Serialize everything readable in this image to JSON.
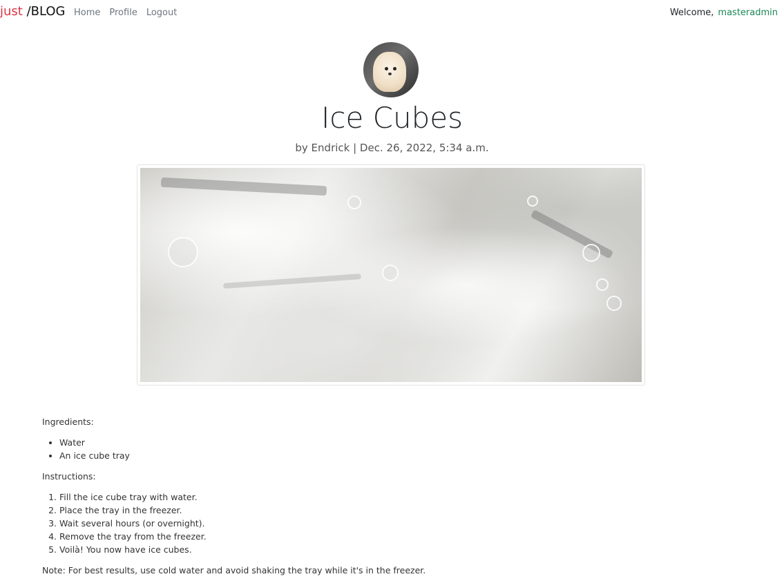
{
  "navbar": {
    "brand_part1": "just",
    "brand_part2": " /BLOG",
    "links": [
      "Home",
      "Profile",
      "Logout"
    ],
    "welcome_label": "Welcome,",
    "username": "masteradmin"
  },
  "post": {
    "title": "Ice Cubes",
    "byline": "by Endrick | Dec. 26, 2022, 5:34 a.m.",
    "ingredients_label": "Ingredients:",
    "ingredients": [
      "Water",
      "An ice cube tray"
    ],
    "instructions_label": "Instructions:",
    "instructions": [
      "Fill the ice cube tray with water.",
      "Place the tray in the freezer.",
      "Wait several hours (or overnight).",
      "Remove the tray from the freezer.",
      "Voilà! You now have ice cubes."
    ],
    "note": "Note: For best results, use cold water and avoid shaking the tray while it's in the freezer."
  },
  "colors": {
    "brand_accent": "#dc3545",
    "username": "#198754",
    "nav_link": "#6c757d"
  }
}
